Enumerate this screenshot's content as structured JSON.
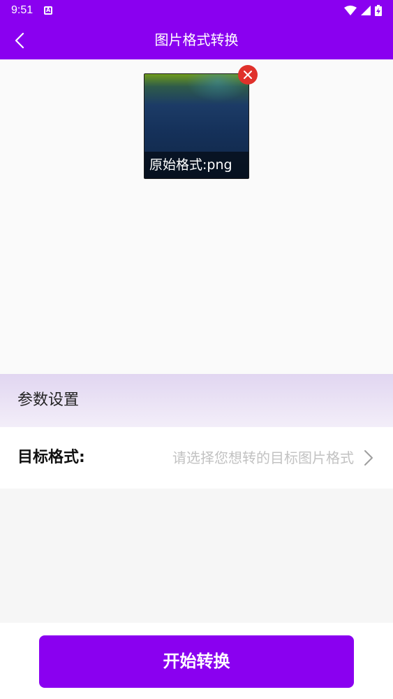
{
  "status_bar": {
    "time": "9:51",
    "notification_icon": "a-icon",
    "wifi_icon": "wifi-icon",
    "signal_icon": "signal-icon",
    "battery_icon": "battery-charging-icon"
  },
  "app_bar": {
    "title": "图片格式转换",
    "back_icon": "chevron-left-icon"
  },
  "image": {
    "caption": "原始格式:png",
    "remove_icon": "close-icon"
  },
  "section": {
    "title": "参数设置"
  },
  "target_format": {
    "label": "目标格式:",
    "placeholder": "请选择您想转的目标图片格式",
    "chevron_icon": "chevron-right-icon"
  },
  "actions": {
    "start_label": "开始转换"
  },
  "colors": {
    "primary": "#8a00f0",
    "remove": "#e0312b",
    "placeholder": "#c2c2c2"
  }
}
